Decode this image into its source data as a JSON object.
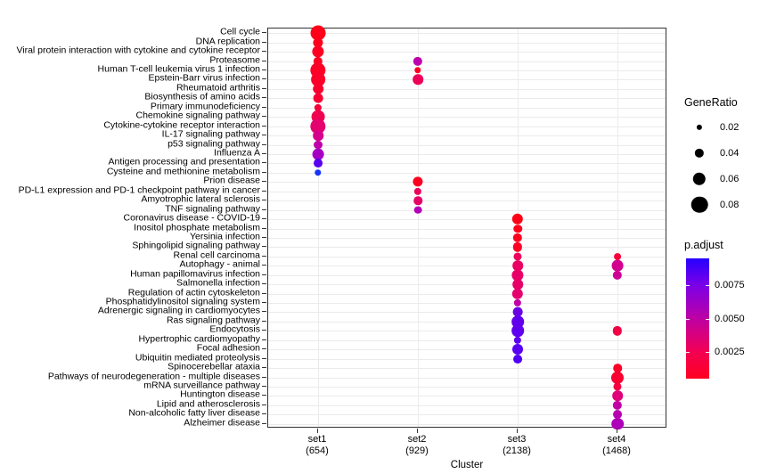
{
  "chart_data": {
    "type": "scatter",
    "title": "",
    "xlabel": "Cluster",
    "ylabel": "",
    "categories_x": [
      "set1",
      "set2",
      "set3",
      "set4"
    ],
    "x_sublabels": [
      "(654)",
      "(929)",
      "(2138)",
      "(1468)"
    ],
    "categories_y": [
      "Cell cycle",
      "DNA replication",
      "Viral protein interaction with cytokine and cytokine receptor",
      "Proteasome",
      "Human T-cell leukemia virus 1 infection",
      "Epstein-Barr virus infection",
      "Rheumatoid arthritis",
      "Biosynthesis of amino acids",
      "Primary immunodeficiency",
      "Chemokine signaling pathway",
      "Cytokine-cytokine receptor interaction",
      "IL-17 signaling pathway",
      "p53 signaling pathway",
      "Influenza A",
      "Antigen processing and presentation",
      "Cysteine and methionine metabolism",
      "Prion disease",
      "PD-L1 expression and PD-1 checkpoint pathway in cancer",
      "Amyotrophic lateral sclerosis",
      "TNF signaling pathway",
      "Coronavirus disease - COVID-19",
      "Inositol phosphate metabolism",
      "Yersinia infection",
      "Sphingolipid signaling pathway",
      "Renal cell carcinoma",
      "Autophagy - animal",
      "Human papillomavirus infection",
      "Salmonella infection",
      "Regulation of actin cytoskeleton",
      "Phosphatidylinositol signaling system",
      "Adrenergic signaling in cardiomyocytes",
      "Ras signaling pathway",
      "Endocytosis",
      "Hypertrophic cardiomyopathy",
      "Focal adhesion",
      "Ubiquitin mediated proteolysis",
      "Spinocerebellar ataxia",
      "Pathways of neurodegeneration - multiple diseases",
      "mRNA surveillance pathway",
      "Huntington disease",
      "Lipid and atherosclerosis",
      "Non-alcoholic fatty liver disease",
      "Alzheimer disease"
    ],
    "size_legend": {
      "title": "GeneRatio",
      "values": [
        0.02,
        0.04,
        0.06,
        0.08
      ],
      "labels": [
        "0.02",
        "0.04",
        "0.06",
        "0.08"
      ]
    },
    "color_legend": {
      "title": "p.adjust",
      "ticks": [
        0.0075,
        0.005,
        0.0025
      ],
      "labels": [
        "0.0075",
        "0.0050",
        "0.0025"
      ],
      "low_color": "#ff0020",
      "high_color": "#2600ff",
      "range": [
        0.0005,
        0.0095
      ]
    },
    "points": [
      {
        "cluster": "set1",
        "pathway": "Cell cycle",
        "gene_ratio": 0.072,
        "p_adjust": 0.0004,
        "color": "#ff0018"
      },
      {
        "cluster": "set1",
        "pathway": "DNA replication",
        "gene_ratio": 0.044,
        "p_adjust": 0.0005,
        "color": "#ff001c"
      },
      {
        "cluster": "set1",
        "pathway": "Viral protein interaction with cytokine and cytokine receptor",
        "gene_ratio": 0.054,
        "p_adjust": 0.0006,
        "color": "#fd0022"
      },
      {
        "cluster": "set1",
        "pathway": "Proteasome",
        "gene_ratio": 0.04,
        "p_adjust": 0.0007,
        "color": "#fd0024"
      },
      {
        "cluster": "set1",
        "pathway": "Human T-cell leukemia virus 1 infection",
        "gene_ratio": 0.074,
        "p_adjust": 0.0008,
        "color": "#fc0026"
      },
      {
        "cluster": "set1",
        "pathway": "Epstein-Barr virus infection",
        "gene_ratio": 0.066,
        "p_adjust": 0.0009,
        "color": "#fb0028"
      },
      {
        "cluster": "set1",
        "pathway": "Rheumatoid arthritis",
        "gene_ratio": 0.046,
        "p_adjust": 0.0011,
        "color": "#fa002c"
      },
      {
        "cluster": "set1",
        "pathway": "Biosynthesis of amino acids",
        "gene_ratio": 0.042,
        "p_adjust": 0.0013,
        "color": "#f90032"
      },
      {
        "cluster": "set1",
        "pathway": "Primary immunodeficiency",
        "gene_ratio": 0.03,
        "p_adjust": 0.0015,
        "color": "#f70038"
      },
      {
        "cluster": "set1",
        "pathway": "Chemokine signaling pathway",
        "gene_ratio": 0.062,
        "p_adjust": 0.0022,
        "color": "#ef0050"
      },
      {
        "cluster": "set1",
        "pathway": "Cytokine-cytokine receptor interaction",
        "gene_ratio": 0.074,
        "p_adjust": 0.003,
        "color": "#e4006e"
      },
      {
        "cluster": "set1",
        "pathway": "IL-17 signaling pathway",
        "gene_ratio": 0.046,
        "p_adjust": 0.0038,
        "color": "#d5008c"
      },
      {
        "cluster": "set1",
        "pathway": "p53 signaling pathway",
        "gene_ratio": 0.038,
        "p_adjust": 0.005,
        "color": "#c000a8"
      },
      {
        "cluster": "set1",
        "pathway": "Influenza A",
        "gene_ratio": 0.052,
        "p_adjust": 0.0058,
        "color": "#a500c4"
      },
      {
        "cluster": "set1",
        "pathway": "Antigen processing and presentation",
        "gene_ratio": 0.038,
        "p_adjust": 0.008,
        "color": "#5a00f0"
      },
      {
        "cluster": "set1",
        "pathway": "Cysteine and methionine metabolism",
        "gene_ratio": 0.026,
        "p_adjust": 0.0092,
        "color": "#1832ff"
      },
      {
        "cluster": "set2",
        "pathway": "Proteasome",
        "gene_ratio": 0.04,
        "p_adjust": 0.0042,
        "color": "#bb00ae"
      },
      {
        "cluster": "set2",
        "pathway": "Human T-cell leukemia virus 1 infection",
        "gene_ratio": 0.026,
        "p_adjust": 0.0006,
        "color": "#fe001e"
      },
      {
        "cluster": "set2",
        "pathway": "Epstein-Barr virus infection",
        "gene_ratio": 0.046,
        "p_adjust": 0.002,
        "color": "#ec0058"
      },
      {
        "cluster": "set2",
        "pathway": "Prion disease",
        "gene_ratio": 0.044,
        "p_adjust": 0.0006,
        "color": "#fd0020"
      },
      {
        "cluster": "set2",
        "pathway": "PD-L1 expression and PD-1 checkpoint pathway in cancer",
        "gene_ratio": 0.03,
        "p_adjust": 0.002,
        "color": "#ec005a"
      },
      {
        "cluster": "set2",
        "pathway": "Amyotrophic lateral sclerosis",
        "gene_ratio": 0.036,
        "p_adjust": 0.0026,
        "color": "#e70066"
      },
      {
        "cluster": "set2",
        "pathway": "TNF signaling pathway",
        "gene_ratio": 0.032,
        "p_adjust": 0.0044,
        "color": "#b400b6"
      },
      {
        "cluster": "set3",
        "pathway": "Coronavirus disease - COVID-19",
        "gene_ratio": 0.05,
        "p_adjust": 0.0004,
        "color": "#ff0016"
      },
      {
        "cluster": "set3",
        "pathway": "Inositol phosphate metabolism",
        "gene_ratio": 0.036,
        "p_adjust": 0.0005,
        "color": "#ff001a"
      },
      {
        "cluster": "set3",
        "pathway": "Yersinia infection",
        "gene_ratio": 0.04,
        "p_adjust": 0.0006,
        "color": "#fe0020"
      },
      {
        "cluster": "set3",
        "pathway": "Sphingolipid signaling pathway",
        "gene_ratio": 0.04,
        "p_adjust": 0.0007,
        "color": "#fd0024"
      },
      {
        "cluster": "set3",
        "pathway": "Renal cell carcinoma",
        "gene_ratio": 0.034,
        "p_adjust": 0.0022,
        "color": "#ec005c"
      },
      {
        "cluster": "set3",
        "pathway": "Autophagy - animal",
        "gene_ratio": 0.046,
        "p_adjust": 0.0024,
        "color": "#ea0062"
      },
      {
        "cluster": "set3",
        "pathway": "Human papillomavirus infection",
        "gene_ratio": 0.054,
        "p_adjust": 0.0026,
        "color": "#e80066"
      },
      {
        "cluster": "set3",
        "pathway": "Salmonella infection",
        "gene_ratio": 0.046,
        "p_adjust": 0.0027,
        "color": "#e70068"
      },
      {
        "cluster": "set3",
        "pathway": "Regulation of actin cytoskeleton",
        "gene_ratio": 0.05,
        "p_adjust": 0.003,
        "color": "#e5006c"
      },
      {
        "cluster": "set3",
        "pathway": "Phosphatidylinositol signaling system",
        "gene_ratio": 0.03,
        "p_adjust": 0.0044,
        "color": "#c000a6"
      },
      {
        "cluster": "set3",
        "pathway": "Adrenergic signaling in cardiomyocytes",
        "gene_ratio": 0.042,
        "p_adjust": 0.0074,
        "color": "#6a00e4"
      },
      {
        "cluster": "set3",
        "pathway": "Ras signaling pathway",
        "gene_ratio": 0.056,
        "p_adjust": 0.0078,
        "color": "#6000ec"
      },
      {
        "cluster": "set3",
        "pathway": "Endocytosis",
        "gene_ratio": 0.056,
        "p_adjust": 0.0079,
        "color": "#5e00ee"
      },
      {
        "cluster": "set3",
        "pathway": "Hypertrophic cardiomyopathy",
        "gene_ratio": 0.03,
        "p_adjust": 0.008,
        "color": "#5c00f0"
      },
      {
        "cluster": "set3",
        "pathway": "Focal adhesion",
        "gene_ratio": 0.048,
        "p_adjust": 0.0082,
        "color": "#5800f2"
      },
      {
        "cluster": "set3",
        "pathway": "Ubiquitin mediated proteolysis",
        "gene_ratio": 0.038,
        "p_adjust": 0.0086,
        "color": "#5000f6"
      },
      {
        "cluster": "set4",
        "pathway": "Renal cell carcinoma",
        "gene_ratio": 0.028,
        "p_adjust": 0.0012,
        "color": "#f6003a"
      },
      {
        "cluster": "set4",
        "pathway": "Autophagy - animal",
        "gene_ratio": 0.052,
        "p_adjust": 0.0036,
        "color": "#d2008e"
      },
      {
        "cluster": "set4",
        "pathway": "Human papillomavirus infection",
        "gene_ratio": 0.04,
        "p_adjust": 0.0038,
        "color": "#ce0094"
      },
      {
        "cluster": "set4",
        "pathway": "Endocytosis",
        "gene_ratio": 0.04,
        "p_adjust": 0.0016,
        "color": "#f20046"
      },
      {
        "cluster": "set4",
        "pathway": "Spinocerebellar ataxia",
        "gene_ratio": 0.036,
        "p_adjust": 0.0008,
        "color": "#fb0028"
      },
      {
        "cluster": "set4",
        "pathway": "Pathways of neurodegeneration - multiple diseases",
        "gene_ratio": 0.058,
        "p_adjust": 0.001,
        "color": "#f90030"
      },
      {
        "cluster": "set4",
        "pathway": "mRNA surveillance pathway",
        "gene_ratio": 0.034,
        "p_adjust": 0.0014,
        "color": "#f50040"
      },
      {
        "cluster": "set4",
        "pathway": "Huntington disease",
        "gene_ratio": 0.046,
        "p_adjust": 0.003,
        "color": "#e0007a"
      },
      {
        "cluster": "set4",
        "pathway": "Lipid and atherosclerosis",
        "gene_ratio": 0.04,
        "p_adjust": 0.0042,
        "color": "#c000a4"
      },
      {
        "cluster": "set4",
        "pathway": "Non-alcoholic fatty liver disease",
        "gene_ratio": 0.038,
        "p_adjust": 0.0046,
        "color": "#b800b0"
      },
      {
        "cluster": "set4",
        "pathway": "Alzheimer disease",
        "gene_ratio": 0.056,
        "p_adjust": 0.005,
        "color": "#ae00ba"
      }
    ]
  }
}
